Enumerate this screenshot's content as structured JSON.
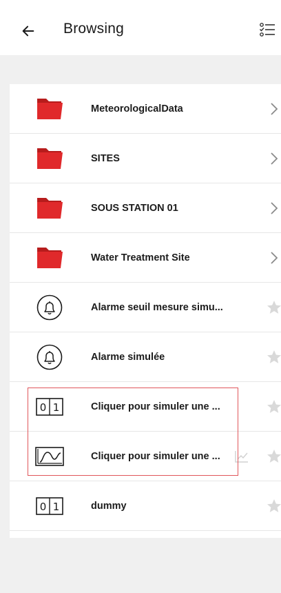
{
  "header": {
    "title": "Browsing",
    "back_icon": "back-arrow-icon",
    "filter_icon": "filter-list-icon"
  },
  "colors": {
    "folder": "#e0292b",
    "folder_dark": "#b71c1c",
    "chevron": "#8a8a8a",
    "star": "#d9d9d9",
    "highlight": "#e0555a"
  },
  "list": {
    "items": [
      {
        "label": "MeteorologicalData",
        "icon": "folder-icon",
        "trailing": "chevron-right-icon"
      },
      {
        "label": "SITES",
        "icon": "folder-icon",
        "trailing": "chevron-right-icon"
      },
      {
        "label": "SOUS STATION 01",
        "icon": "folder-icon",
        "trailing": "chevron-right-icon"
      },
      {
        "label": "Water Treatment Site",
        "icon": "folder-icon",
        "trailing": "chevron-right-icon"
      },
      {
        "label": "Alarme seuil mesure simu...",
        "icon": "bell-icon",
        "trailing": "star-icon"
      },
      {
        "label": "Alarme simulée",
        "icon": "bell-icon",
        "trailing": "star-icon"
      },
      {
        "label": "Cliquer pour simuler une ...",
        "icon": "binary-digital-icon",
        "trailing": "star-icon"
      },
      {
        "label": "Cliquer pour simuler une ...",
        "icon": "analog-curve-icon",
        "trailing": "star-icon",
        "extra": "trend-chart-icon"
      },
      {
        "label": "dummy",
        "icon": "binary-digital-icon",
        "trailing": "star-icon"
      }
    ]
  }
}
